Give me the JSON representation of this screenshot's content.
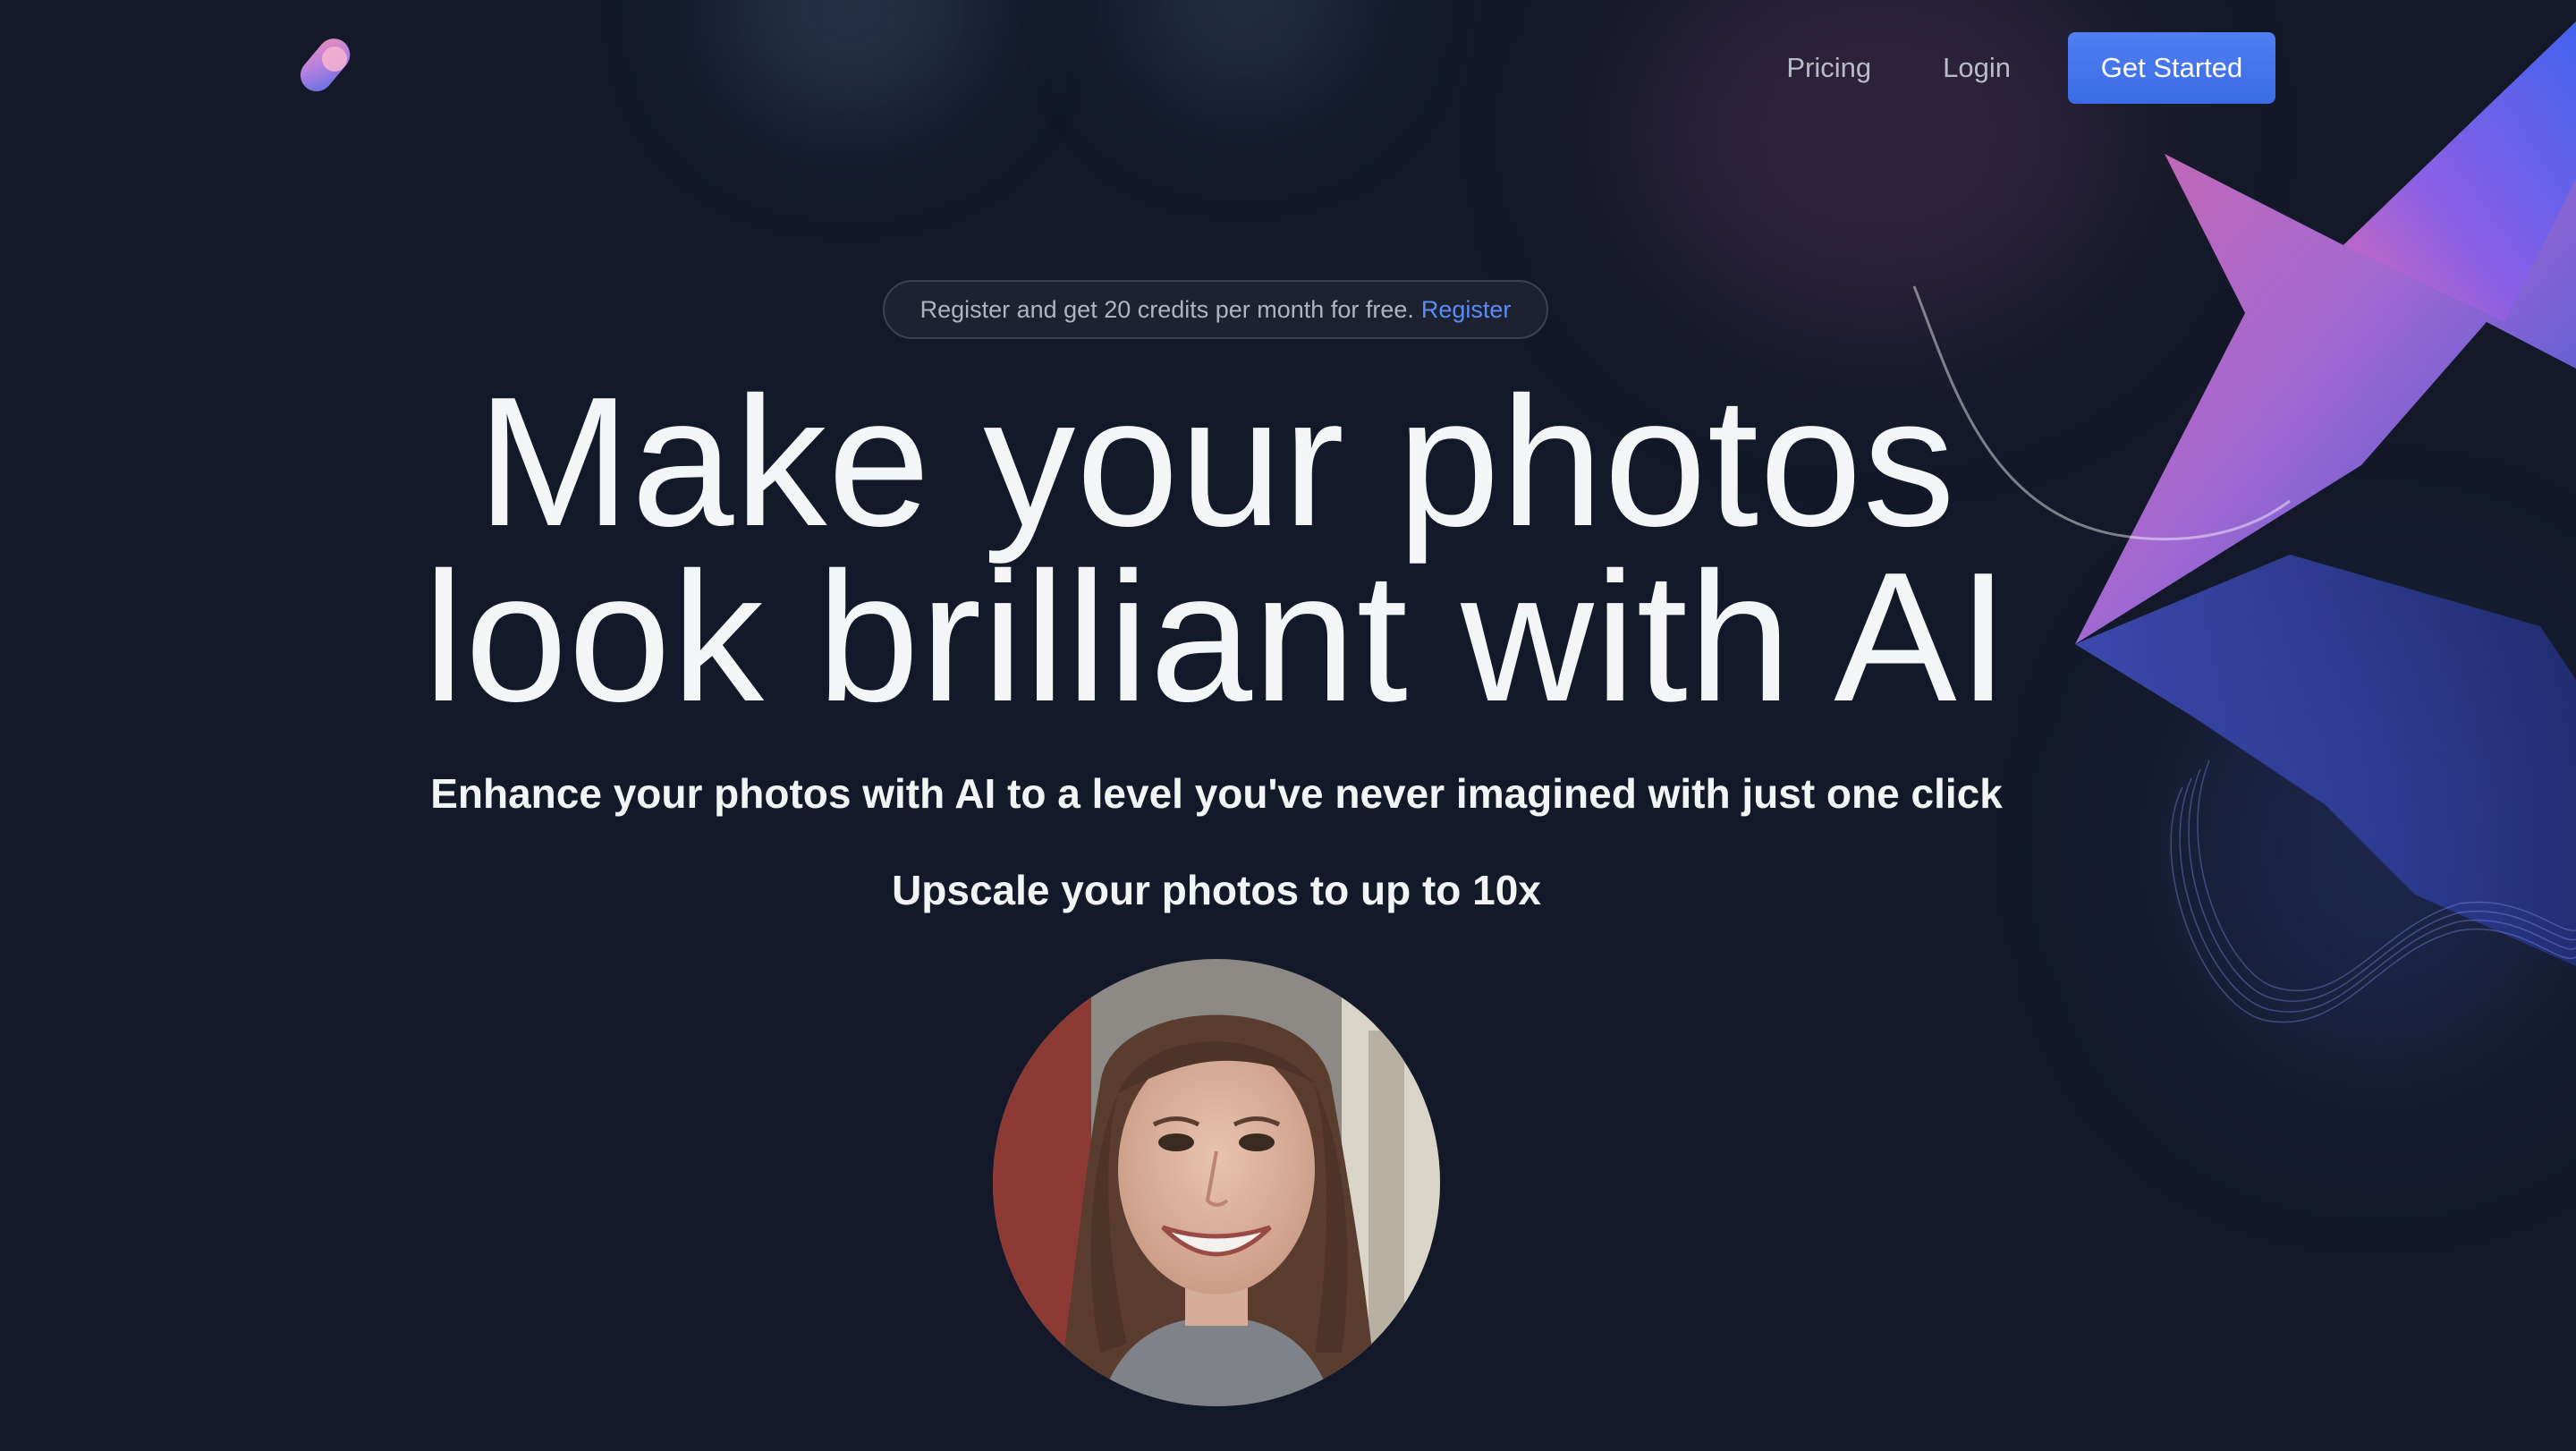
{
  "header": {
    "logo_icon": "gradient-blob-logo-icon",
    "nav": {
      "pricing_label": "Pricing",
      "login_label": "Login",
      "cta_label": "Get Started"
    }
  },
  "announcement": {
    "text": "Register and get 20 credits per month for free.",
    "link_label": "Register"
  },
  "hero": {
    "headline_line1": "Make your photos",
    "headline_line2": "look brilliant with AI",
    "subheadline": "Enhance your photos with AI to a level you've never imagined with just one click",
    "tagline": "Upscale your photos to up to 10x"
  },
  "showcase": {
    "photo_icon": "portrait-photo"
  },
  "colors": {
    "background": "#131928",
    "accent": "#3b6ce6",
    "link": "#5b8cf5",
    "text": "#f3f4f6",
    "muted_text": "#b8bcc6"
  }
}
